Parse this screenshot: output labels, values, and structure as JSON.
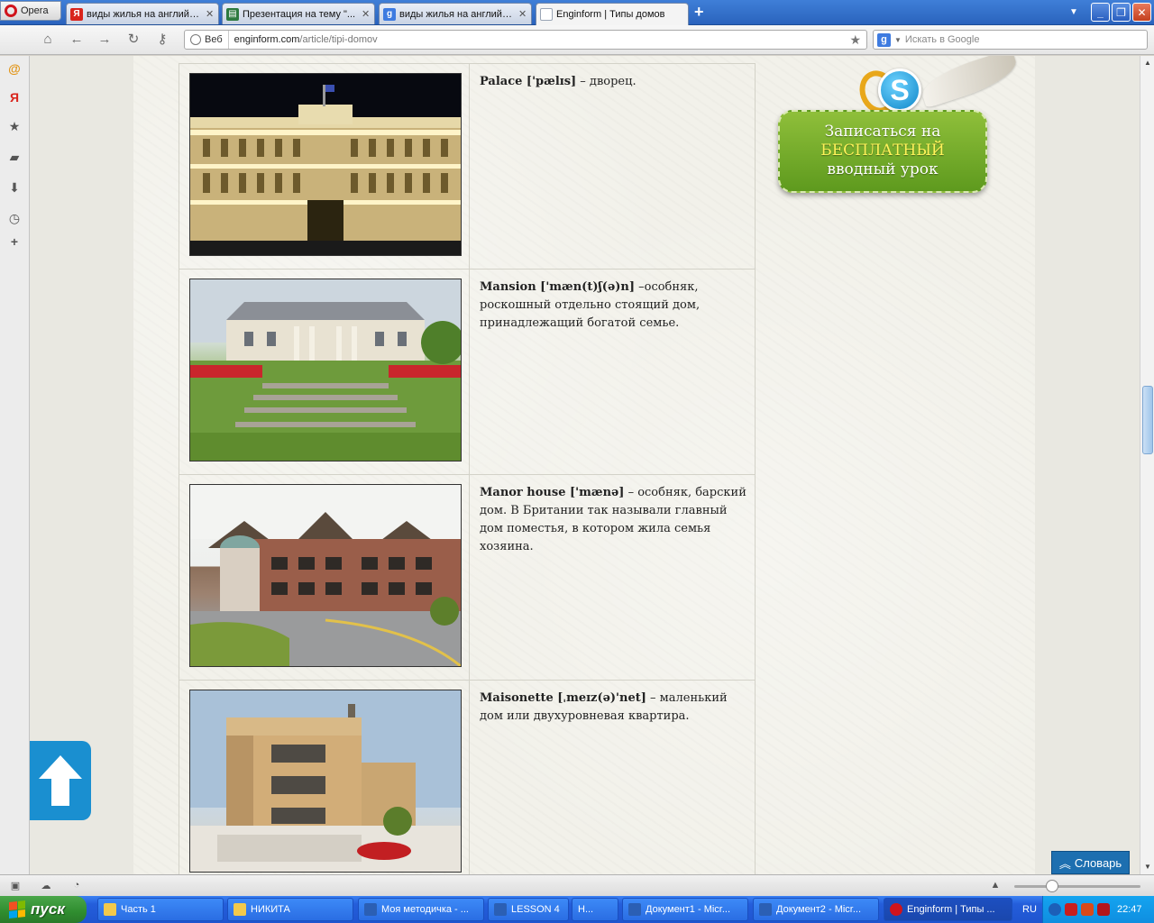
{
  "browser": {
    "menu_label": "Opera",
    "tabs": [
      {
        "title": "виды жилья на английс...",
        "icon": "yandex-icon",
        "color": "#d9241c",
        "glyph": "Я"
      },
      {
        "title": "Презентация на тему \"...",
        "icon": "presentation-icon",
        "color": "#2d7a3f",
        "glyph": "▤"
      },
      {
        "title": "виды жилья на английс...",
        "icon": "google-icon",
        "color": "#3e7be0",
        "glyph": "g"
      },
      {
        "title": "Enginform | Типы домов",
        "icon": "page-icon",
        "color": "#9aa5b5",
        "glyph": "▯"
      }
    ],
    "address": {
      "badge": "Веб",
      "domain": "enginform.com",
      "path": "/article/tipi-domov"
    },
    "search_placeholder": "Искать в Google",
    "search_engine_glyph": "g"
  },
  "article": {
    "rows": [
      {
        "term": "Palace ['pælɪs]",
        "definition": " – дворец."
      },
      {
        "term": "Mansion ['mæn(t)ʃ(ə)n]",
        "definition": " –особняк, роскошный отдельно стоящий дом, принадлежащий богатой семье."
      },
      {
        "term": "Manor house ['mænə]",
        "definition": " – особняк, барский дом. В Британии так называли  главный дом поместья, в котором жила семья хозяина."
      },
      {
        "term": "Maisonette [ˌmeɪz(ə)'net]",
        "definition": " – маленький дом или двухуровневая квартира."
      }
    ]
  },
  "banner": {
    "line1": "Записаться на",
    "line2": "БЕСПЛАТНЫЙ",
    "line3": "вводный урок"
  },
  "dictionary_button": "Словарь",
  "taskbar": {
    "start_label": "пуск",
    "tasks": [
      {
        "title": "Часть 1",
        "icon": "folder-icon",
        "color": "#f2c94c"
      },
      {
        "title": "НИКИТА",
        "icon": "folder-icon",
        "color": "#f2c94c"
      },
      {
        "title": "Моя методичка - ...",
        "icon": "word-icon",
        "color": "#2b5fb4"
      },
      {
        "title": "LESSON 4",
        "icon": "word-icon",
        "color": "#2b5fb4"
      },
      {
        "title": "H...",
        "icon": "generic-icon",
        "color": "#c9d8ef"
      },
      {
        "title": "Документ1 - Micr...",
        "icon": "word-icon",
        "color": "#2b5fb4"
      },
      {
        "title": "Документ2 - Micr...",
        "icon": "word-icon",
        "color": "#2b5fb4"
      },
      {
        "title": "Enginform | Типы ...",
        "icon": "opera-icon",
        "color": "#d0141c"
      }
    ],
    "language": "RU",
    "clock": "22:47"
  }
}
